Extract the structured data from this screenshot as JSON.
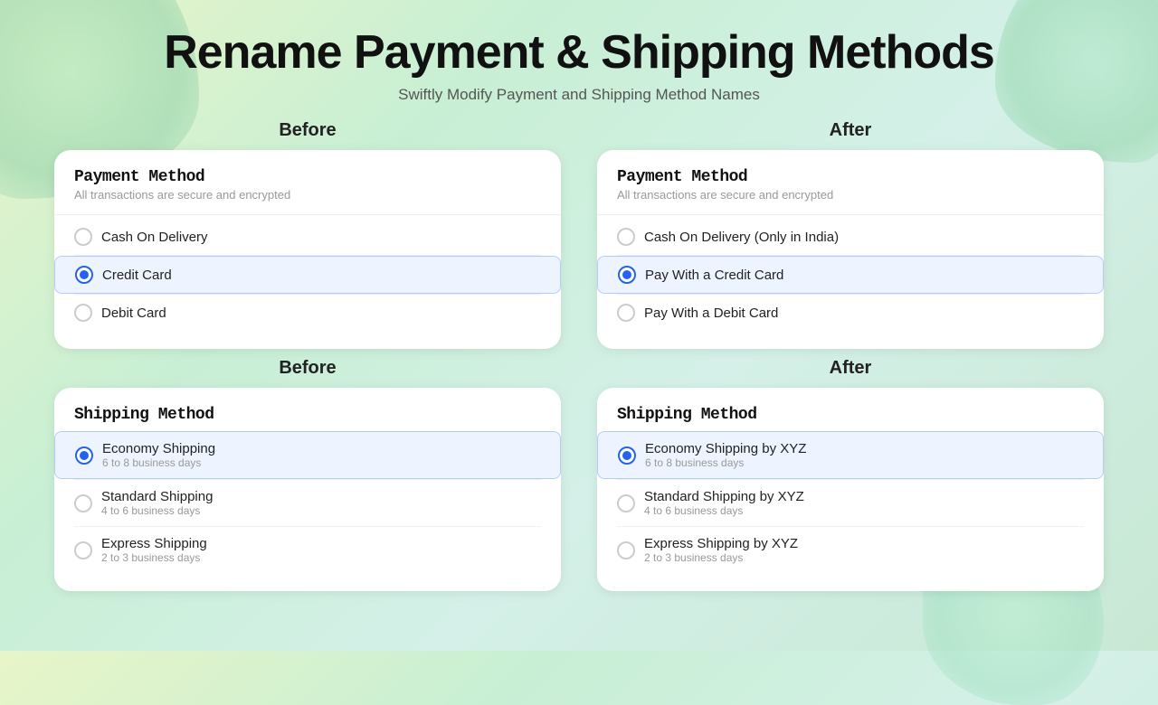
{
  "page": {
    "title": "Rename Payment & Shipping Methods",
    "subtitle": "Swiftly Modify Payment and Shipping Method Names"
  },
  "payment_section": {
    "before_label": "Before",
    "after_label": "After",
    "before": {
      "card_title": "Payment Method",
      "card_subtitle": "All transactions are secure and encrypted",
      "options": [
        {
          "label": "Cash On Delivery",
          "sublabel": "",
          "selected": false
        },
        {
          "label": "Credit Card",
          "sublabel": "",
          "selected": true
        },
        {
          "label": "Debit Card",
          "sublabel": "",
          "selected": false
        }
      ]
    },
    "after": {
      "card_title": "Payment Method",
      "card_subtitle": "All transactions are secure and encrypted",
      "options": [
        {
          "label": "Cash On Delivery (Only in India)",
          "sublabel": "",
          "selected": false
        },
        {
          "label": "Pay With a Credit Card",
          "sublabel": "",
          "selected": true
        },
        {
          "label": "Pay With a Debit Card",
          "sublabel": "",
          "selected": false
        }
      ]
    }
  },
  "shipping_section": {
    "before_label": "Before",
    "after_label": "After",
    "before": {
      "card_title": "Shipping Method",
      "card_subtitle": "",
      "options": [
        {
          "label": "Economy Shipping",
          "sublabel": "6 to 8 business days",
          "selected": true
        },
        {
          "label": "Standard Shipping",
          "sublabel": "4 to 6 business days",
          "selected": false
        },
        {
          "label": "Express Shipping",
          "sublabel": "2 to 3 business days",
          "selected": false
        }
      ]
    },
    "after": {
      "card_title": "Shipping Method",
      "card_subtitle": "",
      "options": [
        {
          "label": "Economy Shipping by XYZ",
          "sublabel": "6 to 8 business days",
          "selected": true
        },
        {
          "label": "Standard Shipping by XYZ",
          "sublabel": "4 to 6 business days",
          "selected": false
        },
        {
          "label": "Express Shipping by XYZ",
          "sublabel": "2 to 3 business days",
          "selected": false
        }
      ]
    }
  }
}
